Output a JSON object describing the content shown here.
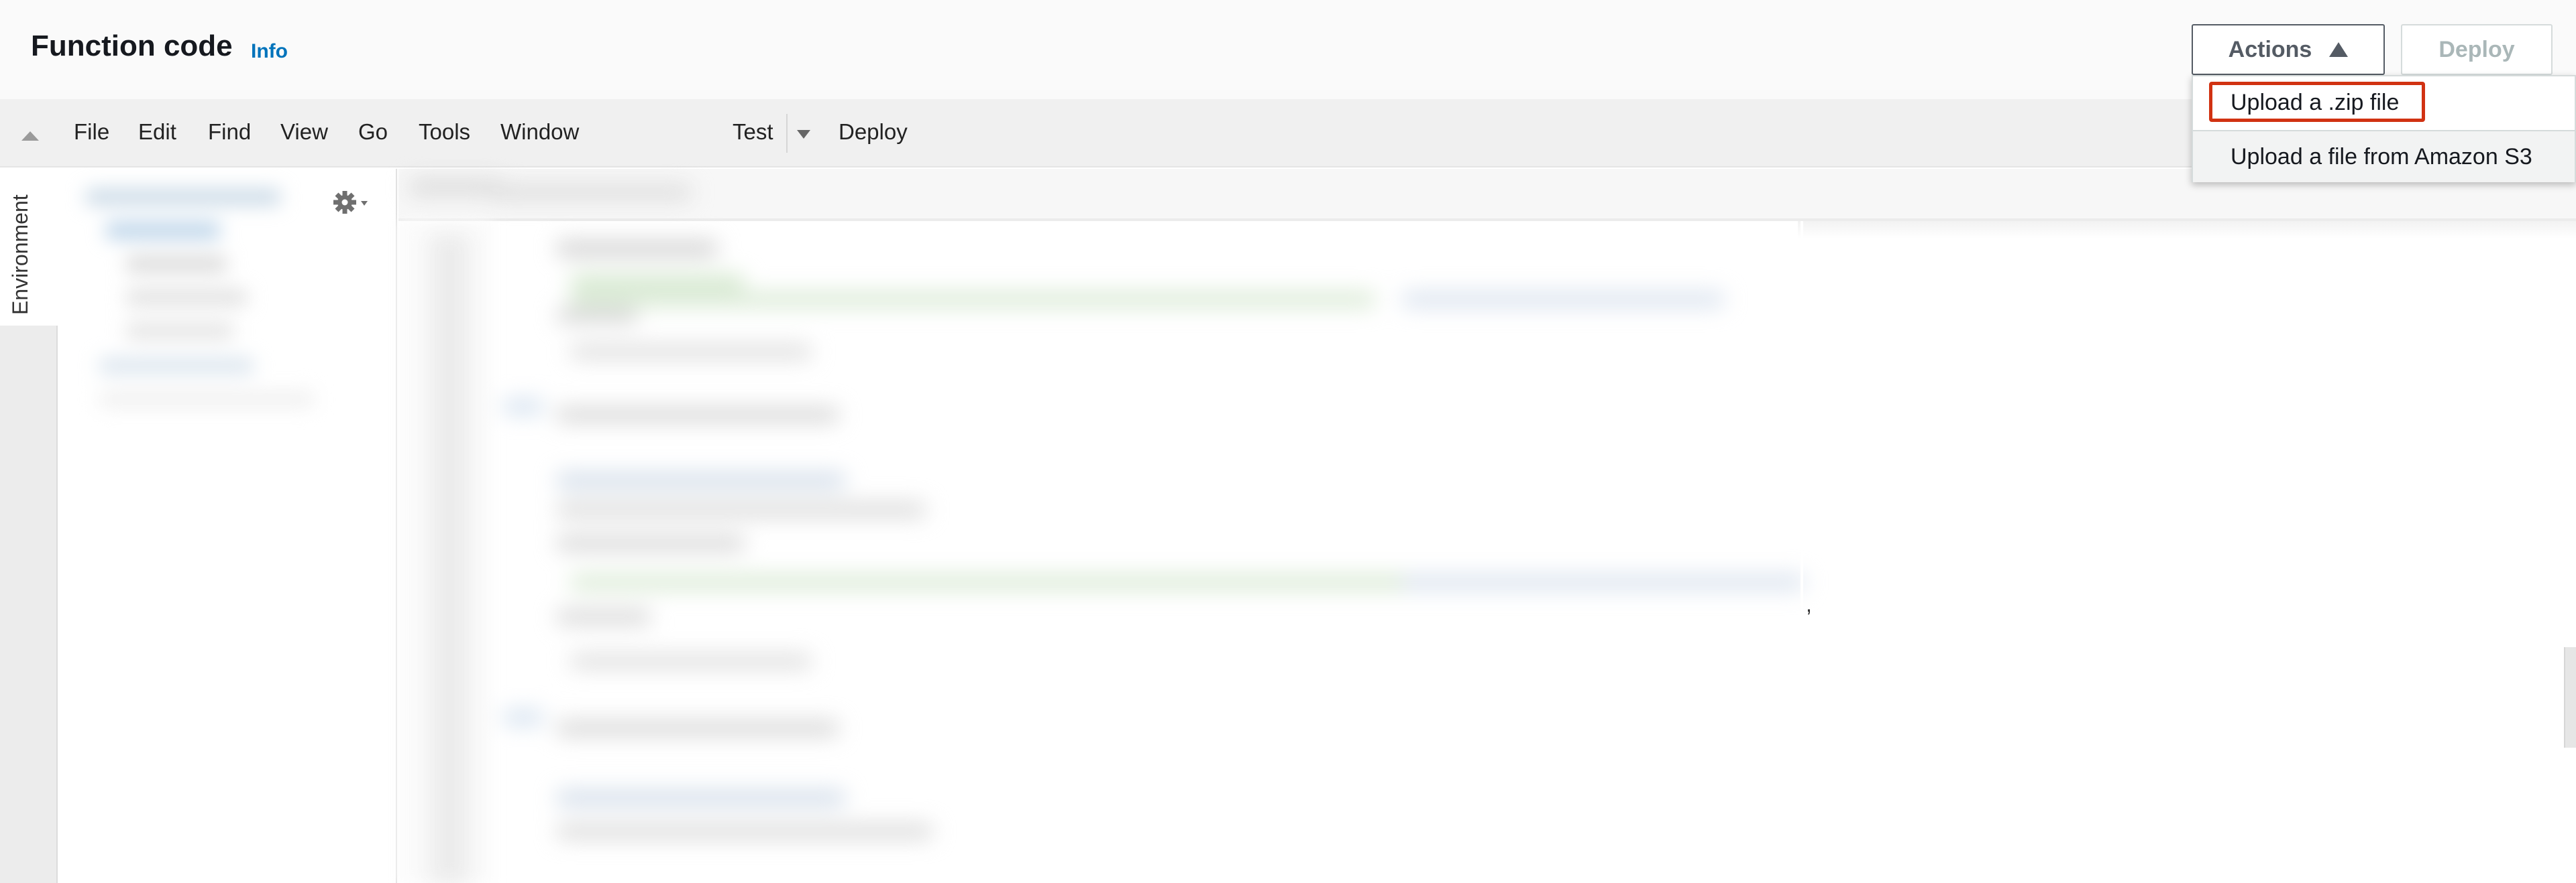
{
  "header": {
    "title": "Function code",
    "info_link": "Info",
    "actions_label": "Actions",
    "deploy_label": "Deploy"
  },
  "menu": {
    "items": [
      "File",
      "Edit",
      "Find",
      "View",
      "Go",
      "Tools",
      "Window"
    ],
    "test_label": "Test",
    "deploy_label": "Deploy"
  },
  "sidebar": {
    "environment_tab": "Environment"
  },
  "dropdown": {
    "items": [
      "Upload a .zip file",
      "Upload a file from Amazon S3"
    ],
    "highlighted_item": "Upload a .zip file"
  },
  "editor": {
    "stray_mark": ","
  },
  "icons": {
    "collapse": "caret-up-icon",
    "actions": "caret-up-icon",
    "test_menu": "caret-down-icon",
    "tree_settings": "gear-icon"
  },
  "colors": {
    "info_link": "#0073bb",
    "highlight_border": "#d13212",
    "disabled_text": "#aab7b8"
  }
}
